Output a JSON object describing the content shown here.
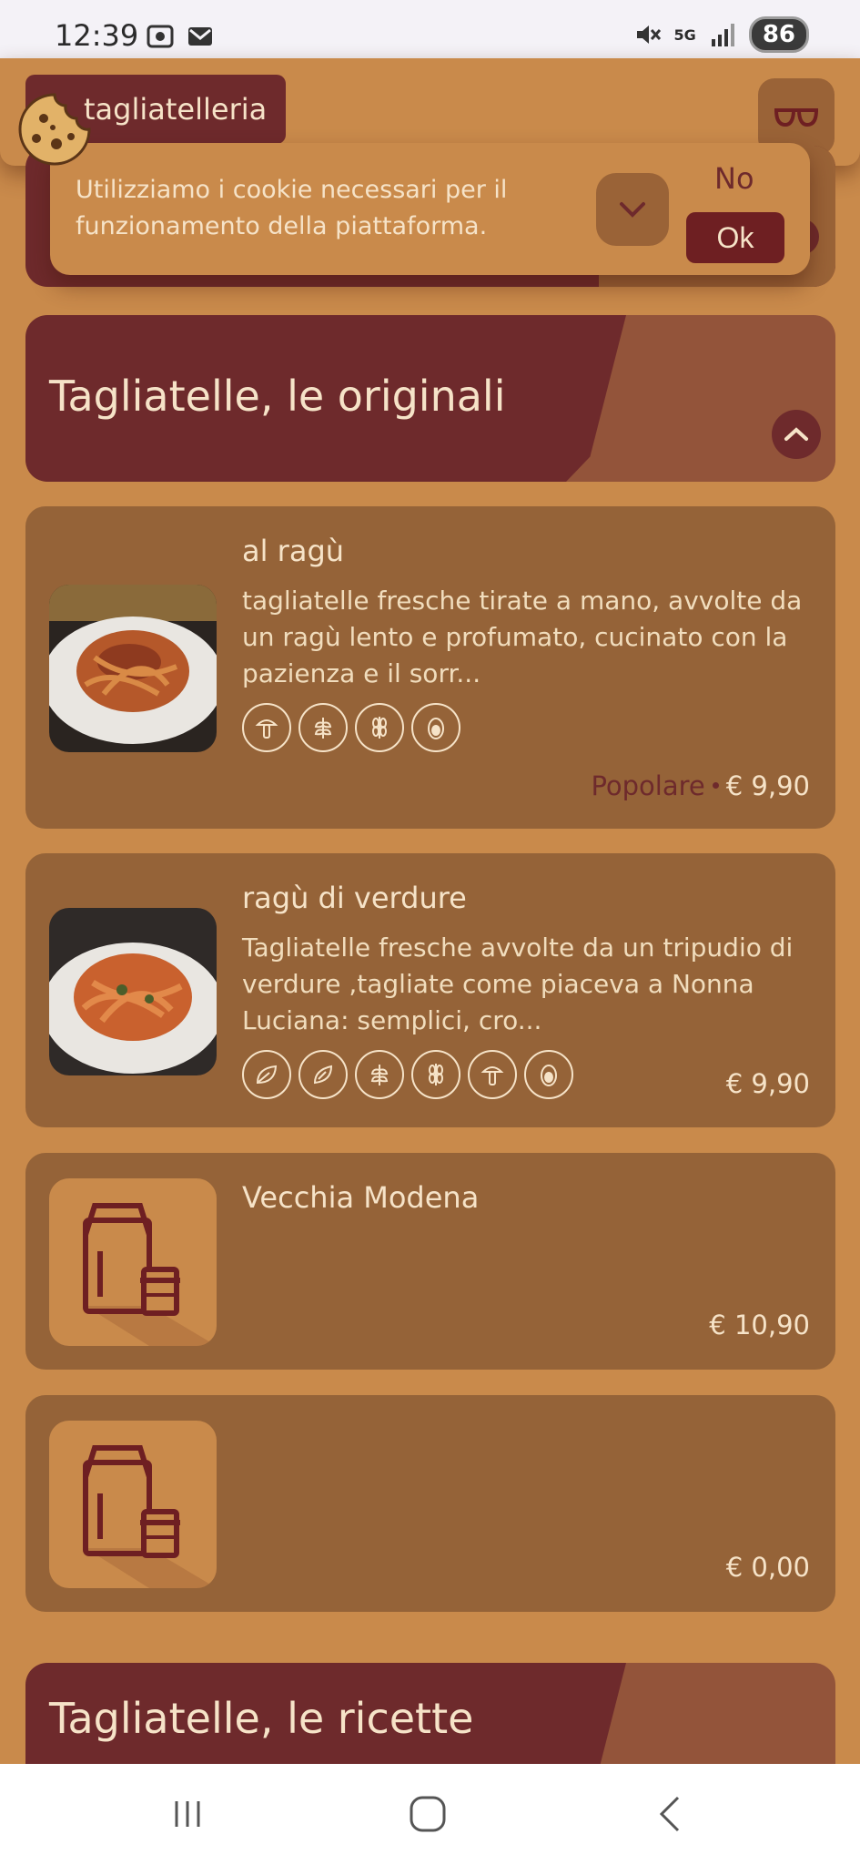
{
  "status_bar": {
    "time": "12:39",
    "battery": "86",
    "network": "5G",
    "left_icons": [
      "screenshot-icon",
      "mail-icon"
    ],
    "right_icons": [
      "mute-icon",
      "network-5g-icon",
      "signal-icon",
      "battery-icon"
    ]
  },
  "header": {
    "brand": "tagliatelleria",
    "accessibility_icon": "glasses-icon"
  },
  "cookie_banner": {
    "text": "Utilizziamo i cookie necessari per il funzionamento della piattaforma.",
    "expand_icon": "chevron-down-icon",
    "no_label": "No",
    "ok_label": "Ok"
  },
  "sections": [
    {
      "title": "Tagliatelle, le originali",
      "collapse_icon": "chevron-up-icon"
    },
    {
      "title": "Tagliatelle, le ricette"
    }
  ],
  "products": [
    {
      "name": "al ragù",
      "description": "tagliatelle fresche tirate a mano, avvolte da un ragù lento e profumato, cucinato con la pazienza e il sorr...",
      "allergens": [
        "mushroom-icon",
        "wheat-leaf-icon",
        "wheat-icon",
        "egg-icon"
      ],
      "badge": "Popolare",
      "price": "€ 9,90"
    },
    {
      "name": "ragù di verdure",
      "description": "Tagliatelle fresche avvolte da un tripudio di verdure ,tagliate come piaceva a Nonna Luciana: semplici, cro...",
      "allergens": [
        "vegan-leaf-icon",
        "vegetarian-leaf-icon",
        "wheat-icon",
        "wheat-ear-icon",
        "mushroom-icon",
        "egg-icon"
      ],
      "price": "€ 9,90"
    },
    {
      "name": "Vecchia Modena",
      "price": "€ 10,90"
    },
    {
      "name": "",
      "price": "€ 0,00"
    }
  ],
  "colors": {
    "background": "#C98A4B",
    "card": "#956338",
    "accent_dark": "#6E2A2C",
    "text_light": "#F6E3C8"
  }
}
